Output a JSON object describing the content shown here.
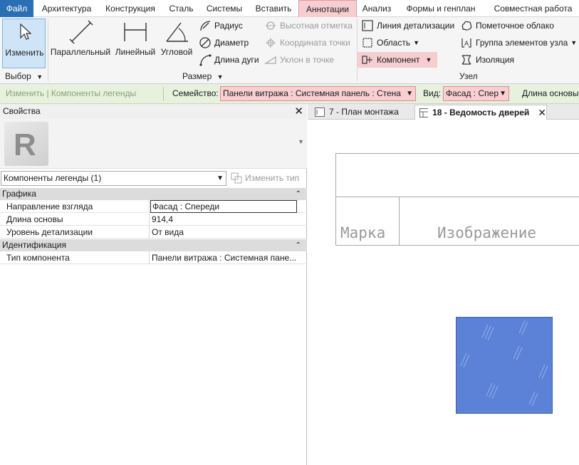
{
  "ribbon_tabs": [
    "Файл",
    "Архитектура",
    "Конструкция",
    "Сталь",
    "Системы",
    "Вставить",
    "Аннотации",
    "Анализ",
    "Формы и генплан",
    "Совместная работа"
  ],
  "ribbon": {
    "modify": {
      "label": "Изменить",
      "group": "Выбор"
    },
    "dimension_group": "Размер",
    "dim_buttons": [
      "Параллельный",
      "Линейный",
      "Угловой"
    ],
    "dim_small": [
      "Радиус",
      "Диаметр",
      "Длина дуги"
    ],
    "dim_disabled": [
      "Высотная отметка",
      "Координата точки",
      "Уклон в точке"
    ],
    "detail_group": "Узел",
    "detail_col1": [
      "Линия детализации",
      "Область",
      "Компонент"
    ],
    "detail_col2": [
      "Пометочное облако",
      "Группа элементов узла",
      "Изоляция"
    ]
  },
  "options_bar": {
    "context": "Изменить | Компоненты легенды",
    "family_label": "Семейство:",
    "family_value": "Панели витража : Системная панель : Стена",
    "view_label": "Вид:",
    "view_value": "Фасад : Спер",
    "length_label": "Длина основы"
  },
  "properties": {
    "title": "Свойства",
    "instance": "Компоненты легенды (1)",
    "edit_type": "Изменить тип",
    "categories": [
      {
        "name": "Графика",
        "rows": [
          {
            "name": "Направление взгляда",
            "value": "Фасад : Спереди"
          },
          {
            "name": "Длина основы",
            "value": "914,4"
          },
          {
            "name": "Уровень детализации",
            "value": "От вида"
          }
        ]
      },
      {
        "name": "Идентификация",
        "rows": [
          {
            "name": "Тип компонента",
            "value": "Панели витража : Системная пане..."
          }
        ]
      }
    ]
  },
  "view_tabs": [
    {
      "label": "7 - План монтажа",
      "active": false
    },
    {
      "label": "18 - Ведомость дверей",
      "active": true
    }
  ],
  "schedule": {
    "col_mark": "Марка",
    "col_image": "Изображение"
  },
  "colors": {
    "accent": "#2a6fb3",
    "highlight": "#f6cdd0",
    "panel": "#5b82d6",
    "options_bar": "#e7f1dd"
  }
}
